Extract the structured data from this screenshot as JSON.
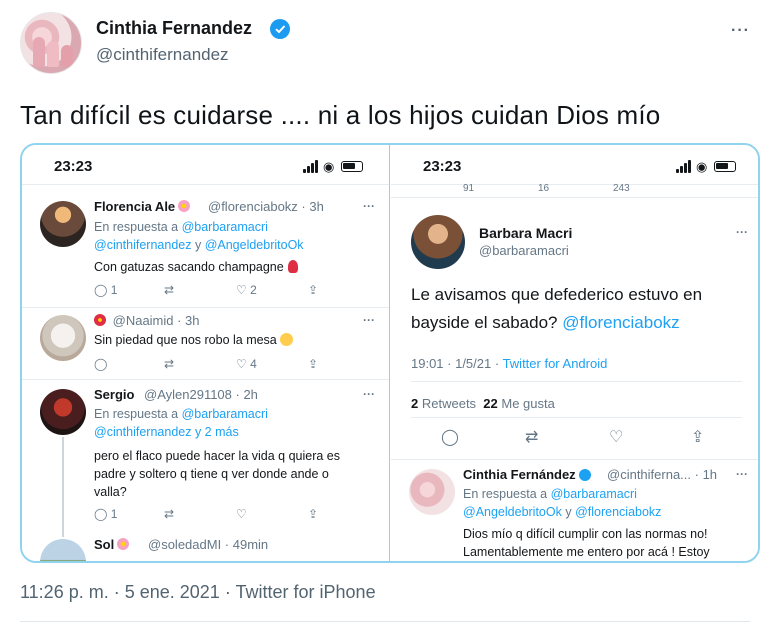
{
  "author": {
    "name": "Cinthia Fernandez",
    "handle": "@cinthifernandez",
    "more": "···"
  },
  "tweet": {
    "text": "Tan difícil es cuidarse .... ni a los hijos cuidan Dios mío",
    "timestamp": "11:26 p. m. · 5 ene. 2021",
    "separator": "·",
    "source": "Twitter for iPhone"
  },
  "left_screenshot": {
    "time": "23:23",
    "replies": [
      {
        "name": "Florencia Ale",
        "handle": "@florenciabokz · 3h",
        "reply_to_prefix": "En respuesta a",
        "reply_to_1": "@barbaramacri",
        "reply_to_2": "@cinthifernandez",
        "reply_to_join": "y",
        "reply_to_3": "@AngeldebritoOk",
        "text": "Con gatuzas sacando champagne",
        "replies": "1",
        "likes": "2"
      },
      {
        "handle": "@Naaimid · 3h",
        "text": "Sin piedad que nos robo la mesa",
        "likes": "4"
      },
      {
        "name": "Sergio",
        "handle": "@Aylen291108 · 2h",
        "reply_to_prefix": "En respuesta a",
        "reply_to_1": "@barbaramacri",
        "reply_to_2": "@cinthifernandez y 2 más",
        "line1": "pero el flaco puede hacer la vida q quiera es",
        "line2": "padre y soltero q tiene q ver donde ande o",
        "line3": "valla?",
        "replies": "1"
      },
      {
        "name": "Sol",
        "handle": "@soledadMI · 49min"
      }
    ]
  },
  "right_screenshot": {
    "time": "23:23",
    "top_counts": [
      "91",
      "16",
      "243"
    ],
    "main_tweet": {
      "name": "Barbara Macri",
      "handle": "@barbaramacri",
      "line1": "Le avisamos que defederico estuvo en",
      "line2_prefix": "bayside el sabado?",
      "line2_mention": "@florenciabokz",
      "time_date": "19:01 · 1/5/21 ·",
      "source": "Twitter for Android",
      "retweets": "2",
      "retweets_label": "Retweets",
      "likes": "22",
      "likes_label": "Me gusta"
    },
    "reply": {
      "name": "Cinthia Fernández",
      "handle": "@cinthiferna...",
      "age": "· 1h",
      "reply_to_prefix": "En respuesta a",
      "reply_to_1": "@barbaramacri",
      "reply_to_2": "@AngeldebritoOk",
      "reply_to_join": "y",
      "reply_to_3": "@florenciabokz",
      "line1": "Dios mío q difícil cumplir con las normas no!",
      "line2": "Lamentablemente me entero por acá ! Estoy"
    }
  },
  "colors": {
    "link": "#1da1f2",
    "verified": "#1d9bf0",
    "frame": "#8fd3ee"
  }
}
